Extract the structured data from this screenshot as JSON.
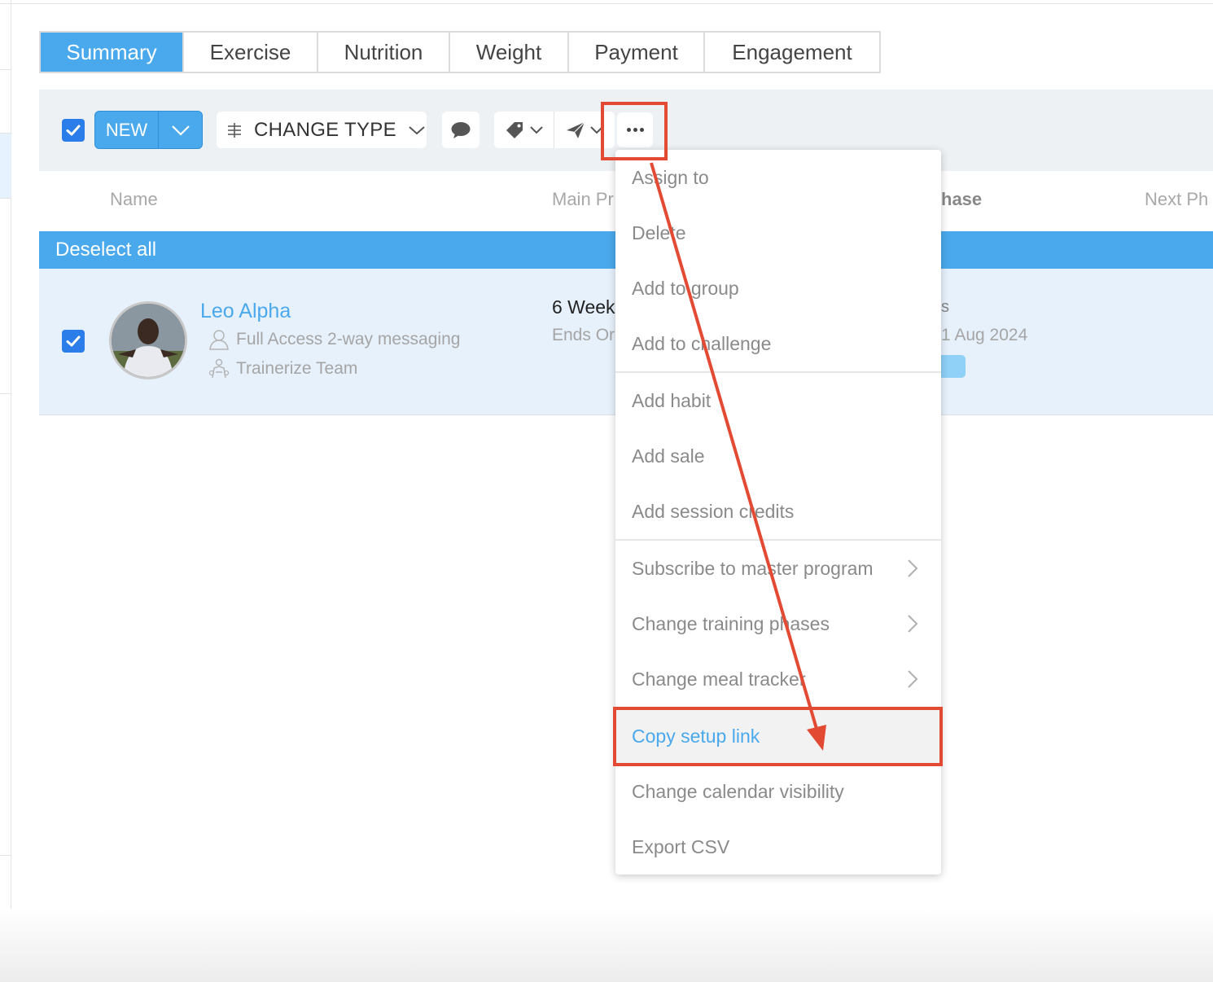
{
  "tabs": [
    {
      "label": "Summary",
      "active": true
    },
    {
      "label": "Exercise"
    },
    {
      "label": "Nutrition"
    },
    {
      "label": "Weight"
    },
    {
      "label": "Payment"
    },
    {
      "label": "Engagement"
    }
  ],
  "toolbar": {
    "new_label": "NEW",
    "change_type_label": "CHANGE TYPE"
  },
  "table": {
    "columns": {
      "name": "Name",
      "main_program": "Main Pr",
      "phase": "hase",
      "next_phase": "Next Ph"
    },
    "deselect_label": "Deselect all",
    "row": {
      "name": "Leo Alpha",
      "access": "Full Access 2-way messaging",
      "team": "Trainerize Team",
      "program": "6 Week",
      "program_sub": "Ends Or",
      "phase_frag": "s",
      "date_frag": "1 Aug 2024"
    }
  },
  "menu": {
    "items": [
      "Assign to",
      "Delete",
      "Add to group",
      "Add to challenge",
      "Add habit",
      "Add sale",
      "Add session credits",
      "Subscribe to master program",
      "Change training phases",
      "Change meal tracker",
      "Copy setup link",
      "Change calendar visibility",
      "Export CSV"
    ],
    "highlighted": "Copy setup link"
  },
  "colors": {
    "accent": "#4aa9ec",
    "annotation": "#e34a33",
    "checkbox": "#2b7de9"
  }
}
